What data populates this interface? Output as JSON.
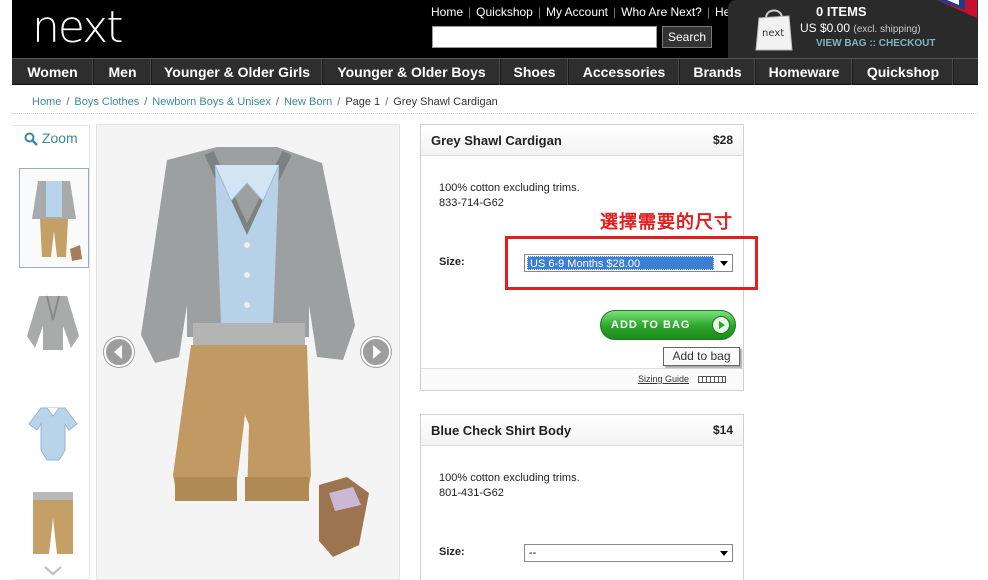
{
  "header": {
    "logo": "next",
    "links": [
      "Home",
      "Quickshop",
      "My Account",
      "Who Are Next?",
      "Help"
    ],
    "search_button": "Search",
    "bag_logo": "next",
    "bag_items": "0 ITEMS",
    "bag_total": "US $0.00",
    "bag_shipping": "(excl. shipping)",
    "bag_links": "VIEW BAG :: CHECKOUT"
  },
  "nav": [
    "Women",
    "Men",
    "Younger & Older Girls",
    "Younger & Older Boys",
    "Shoes",
    "Accessories",
    "Brands",
    "Homeware",
    "Quickshop"
  ],
  "breadcrumb": {
    "links": [
      "Home",
      "Boys Clothes",
      "Newborn Boys & Unisex",
      "New Born"
    ],
    "page": "Page 1",
    "current": "Grey Shawl Cardigan"
  },
  "gallery": {
    "zoom_label": "Zoom"
  },
  "products": [
    {
      "name": "Grey Shawl Cardigan",
      "price": "$28",
      "description": "100% cotton excluding trims.",
      "code": "833-714-G62",
      "size_label": "Size:",
      "size_selected": "US 6-9 Months $28.00"
    },
    {
      "name": "Blue Check Shirt Body",
      "price": "$14",
      "description": "100% cotton excluding trims.",
      "code": "801-431-G62",
      "size_label": "Size:",
      "size_selected": "--"
    }
  ],
  "add_to_bag_label": "ADD TO BAG",
  "tooltip": "Add to bag",
  "sizing_guide": "Sizing Guide",
  "annotation": "選擇需要的尺寸",
  "colors": {
    "link_teal": "#3a8a9a",
    "highlight_red": "#e02020",
    "button_green": "#2aa42a",
    "select_blue": "#3a7fd5"
  }
}
